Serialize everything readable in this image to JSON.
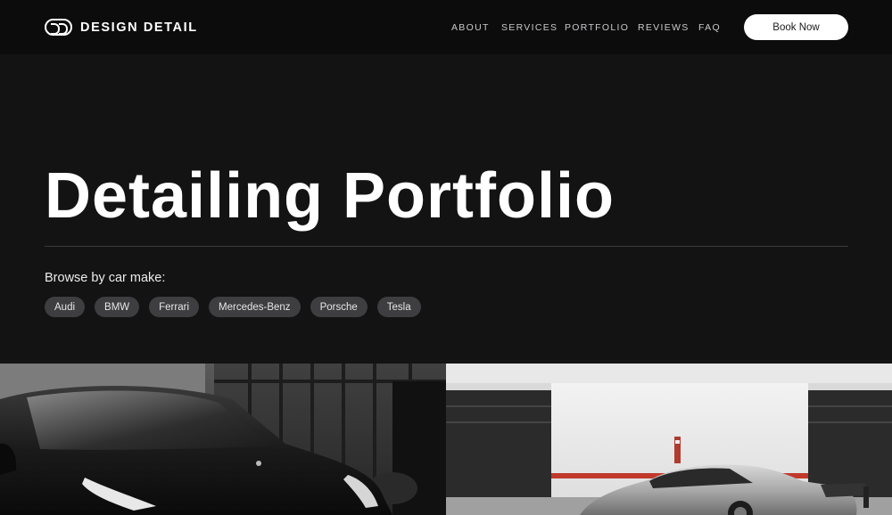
{
  "header": {
    "brand": "DESIGN DETAIL",
    "nav": [
      "ABOUT",
      "SERVICES",
      "PORTFOLIO",
      "REVIEWS",
      "FAQ"
    ],
    "cta": "Book Now"
  },
  "hero": {
    "title": "Detailing Portfolio",
    "browse_label": "Browse by car make:",
    "makes": [
      "Audi",
      "BMW",
      "Ferrari",
      "Mercedes-Benz",
      "Porsche",
      "Tesla"
    ]
  },
  "colors": {
    "background": "#131314",
    "header": "#0c0c0d",
    "chip": "#3e3e40",
    "accent_stripe": "#c0392b"
  },
  "gallery": [
    {
      "alt": "Black Tesla sedan in front of glass building"
    },
    {
      "alt": "Silver Porsche sports car in parking garage"
    }
  ]
}
